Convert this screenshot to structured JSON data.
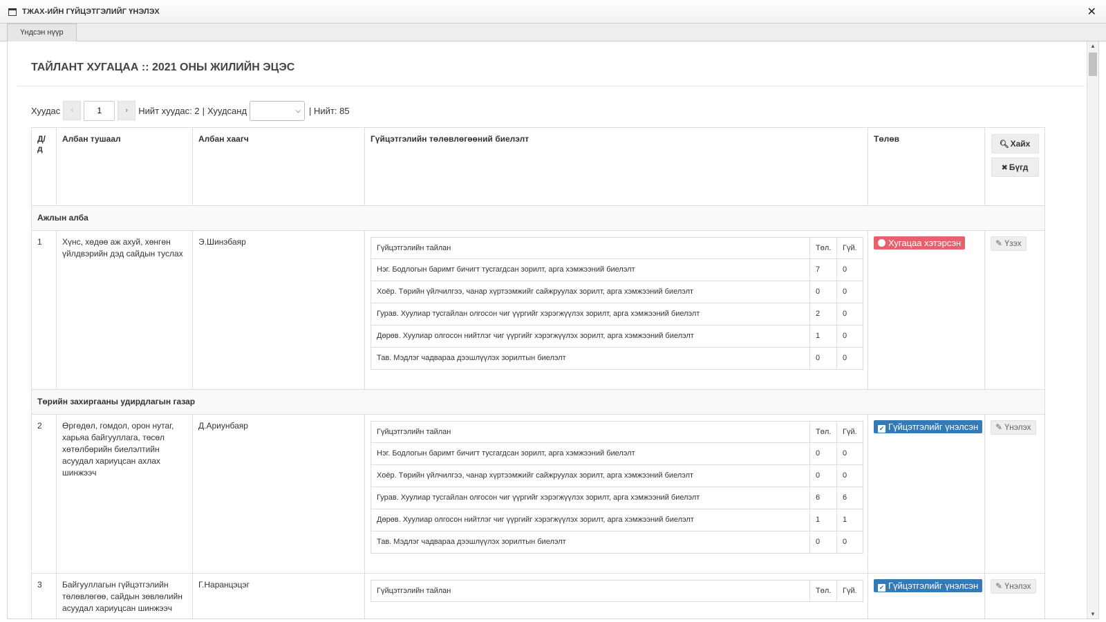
{
  "window": {
    "title": "ТЖАХ-ИЙН ГҮЙЦЭТГЭЛИЙГ ҮНЭЛЭХ",
    "close_label": "✕"
  },
  "tabs": [
    {
      "label": "Үндсэн нүүр"
    }
  ],
  "page": {
    "title": "ТАЙЛАНТ ХУГАЦАА :: 2021 ОНЫ ЖИЛИЙН ЭЦЭС"
  },
  "pager": {
    "page_label": "Хуудас",
    "current_page": "1",
    "total_pages_text": "Нийт хуудас: 2",
    "separator": "|",
    "per_page_label": "Хуудсанд",
    "per_page_value": "",
    "total_text": "| Нийт: 85",
    "prev_icon": "‹",
    "next_icon": "›"
  },
  "grid": {
    "headers": {
      "index": "Д/д",
      "position": "Албан тушаал",
      "employee": "Албан хаагч",
      "execution": "Гүйцэтгэлийн төлөвлөгөөний биелэлт",
      "status": "Төлөв"
    },
    "search_label": "Хайх",
    "clear_label": "Бүгд"
  },
  "report": {
    "header": {
      "title": "Гүйцэтгэлийн тайлан",
      "col_planned": "Төл.",
      "col_done": "Гүй."
    },
    "items": [
      "Нэг. Бодлогын баримт бичигт тусгагдсан зорилт, арга хэмжээний биелэлт",
      "Хоёр. Төрийн үйлчилгээ, чанар хүртээмжийг сайжруулах зорилт, арга хэмжээний биелэлт",
      "Гурав. Хуулиар тусгайлан олгосон чиг үүргийг хэрэгжүүлэх зорилт, арга хэмжээний биелэлт",
      "Дөрөв. Хуулиар олгосон нийтлэг чиг үүргийг хэрэгжүүлэх зорилт, арга хэмжээний биелэлт",
      "Тав. Мэдлэг чадвараа дээшлүүлэх зорилтын биелэлт"
    ]
  },
  "groups": [
    {
      "name": "Ажлын алба",
      "rows": [
        {
          "index": "1",
          "position": "Хүнс, хөдөө аж ахуй, хөнгөн үйлдвэрийн дэд сайдын туслах",
          "employee": "Э.Шинэбаяр",
          "values": [
            [
              "7",
              "0"
            ],
            [
              "0",
              "0"
            ],
            [
              "2",
              "0"
            ],
            [
              "1",
              "0"
            ],
            [
              "0",
              "0"
            ]
          ],
          "status": "Хугацаа хэтэрсэн",
          "status_color": "#e9606d",
          "action": "Үзэх"
        }
      ]
    },
    {
      "name": "Төрийн захиргааны удирдлагын газар",
      "rows": [
        {
          "index": "2",
          "position": "Өргөдөл, гомдол, орон нутаг, харьяа байгууллага, төсөл хөтөлбөрийн биелэлтийн асуудал хариуцсан ахлах шинжээч",
          "employee": "Д.Ариунбаяр",
          "values": [
            [
              "0",
              "0"
            ],
            [
              "0",
              "0"
            ],
            [
              "6",
              "6"
            ],
            [
              "1",
              "1"
            ],
            [
              "0",
              "0"
            ]
          ],
          "status": "Гүйцэтгэлийг үнэлсэн",
          "status_color": "#337ab7",
          "action": "Үнэлэх"
        },
        {
          "index": "3",
          "position": "Байгууллагын гүйцэтгэлийн төлөвлөгөө, сайдын зөвлөлийн асуудал хариуцсан шинжээч",
          "employee": "Г.Наранцэцэг",
          "values": [],
          "status": "Гүйцэтгэлийг үнэлсэн",
          "status_color": "#337ab7",
          "action": "Үнэлэх"
        }
      ]
    }
  ]
}
